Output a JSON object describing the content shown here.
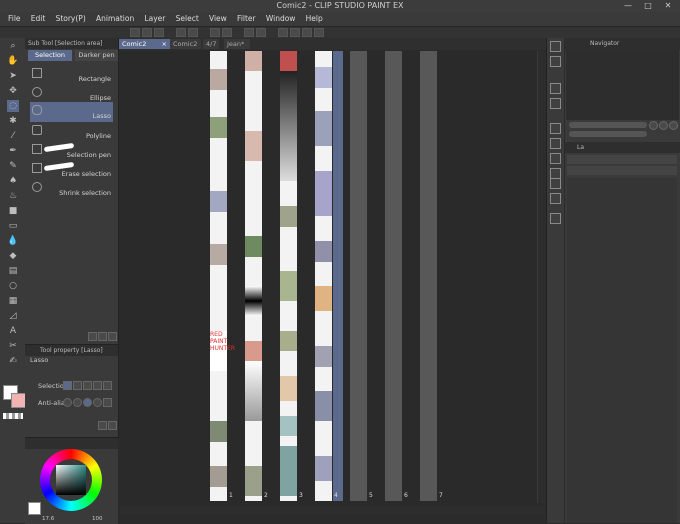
{
  "window": {
    "title": "Comic2 - CLIP STUDIO PAINT EX"
  },
  "menu": [
    "File",
    "Edit",
    "Story(P)",
    "Animation",
    "Layer",
    "Select",
    "View",
    "Filter",
    "Window",
    "Help"
  ],
  "subtool": {
    "header": "Sub Tool [Selection area]",
    "tabs": [
      "Selection",
      "Darker pen"
    ],
    "items": [
      {
        "label": "Rectangle"
      },
      {
        "label": "Ellipse"
      },
      {
        "label": "Lasso"
      },
      {
        "label": "Polyline"
      },
      {
        "label": "Selection pen"
      },
      {
        "label": "Erase selection"
      },
      {
        "label": "Shrink selection"
      }
    ]
  },
  "toolproperty": {
    "header": "Tool property [Lasso]",
    "tool_name": "Lasso",
    "selection_label": "Selection",
    "antialias_label": "Anti-alias"
  },
  "canvas": {
    "tabs": [
      "Comic2",
      "Comic2",
      "4/7",
      "Jean*"
    ],
    "page_numbers": [
      "1",
      "2",
      "3",
      "4",
      "5",
      "6",
      "7"
    ]
  },
  "navigator": {
    "title": "Navigator"
  },
  "layer": {
    "title": "La"
  },
  "status": {
    "zoom_left": "17.6",
    "zoom_right": "100"
  },
  "colors": {
    "accent": "#5b6a8c",
    "main_color": "#ffffff",
    "sub_color": "#f2b3b3",
    "panel_bg": "#3a3a3a"
  },
  "red_text_on_page": "RED PAINT HUNTER"
}
